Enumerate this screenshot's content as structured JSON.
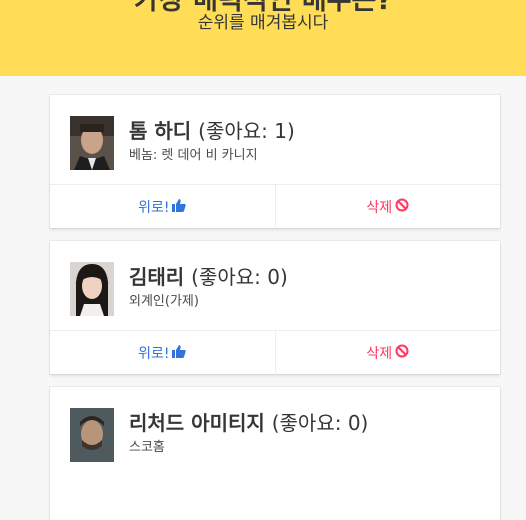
{
  "header": {
    "title": "가장 매력적인 배우는?",
    "subtitle": "순위를 매겨봅시다"
  },
  "actions": {
    "up_label": "위로!",
    "delete_label": "삭제"
  },
  "colors": {
    "header_bg": "#ffdd57",
    "up": "#3273dc",
    "delete": "#ff3860"
  },
  "actors": [
    {
      "name": "톰 하디",
      "likes": "(좋아요: 1)",
      "desc": "베놈: 렛 데어 비 카니지"
    },
    {
      "name": "김태리",
      "likes": "(좋아요: 0)",
      "desc": "외계인(가제)"
    },
    {
      "name": "리처드 아미티지",
      "likes": "(좋아요: 0)",
      "desc": "스코홈"
    }
  ],
  "icons": {
    "up": "thumbs-up-icon",
    "delete": "ban-icon"
  }
}
